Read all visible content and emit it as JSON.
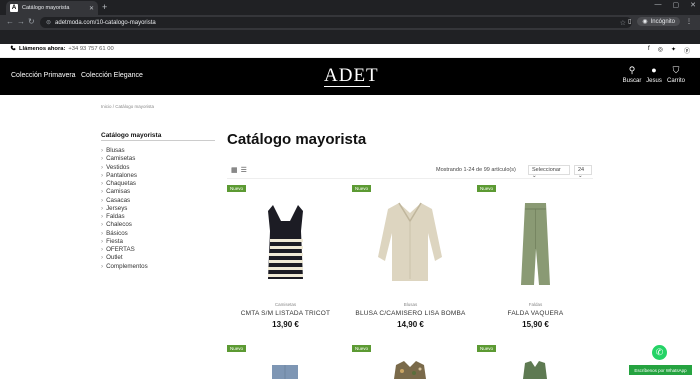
{
  "browser": {
    "tab_title": "Catálogo mayorista",
    "tab_favicon": "A",
    "url": "adetmoda.com/10-catalogo-mayorista",
    "profile_label": "Incógnito"
  },
  "topbar": {
    "phone_label": "Llámenos ahora:",
    "phone_number": "+34 93 757 61 00",
    "social_icons": [
      "facebook-icon",
      "instagram-icon",
      "twitter-icon",
      "pinterest-icon"
    ]
  },
  "nav": {
    "links": [
      "Colección Primavera",
      "Colección Elegance"
    ],
    "logo": "ADET",
    "tools": [
      {
        "icon": "search-icon",
        "label": "Buscar"
      },
      {
        "icon": "user-icon",
        "label": "Jesus"
      },
      {
        "icon": "cart-icon",
        "label": "Carrito"
      }
    ]
  },
  "breadcrumb": "Inicio  /  Catálogo mayorista",
  "sidebar": {
    "title": "Catálogo mayorista",
    "items": [
      "Blusas",
      "Camisetas",
      "Vestidos",
      "Pantalones",
      "Chaquetas",
      "Camisas",
      "Casacas",
      "Jerseys",
      "Faldas",
      "Chalecos",
      "Básicos",
      "Fiesta",
      "OFERTAS",
      "Outlet",
      "Complementos"
    ]
  },
  "main": {
    "title": "Catálogo mayorista",
    "showing": "Mostrando 1-24 de 99 artículo(s)",
    "sort_label": "Seleccionar",
    "per_page": "24"
  },
  "products": [
    {
      "badge": "Nuevo",
      "category": "Camisetas",
      "name": "CMTA S/M LISTADA TRICOT",
      "price": "13,90 €"
    },
    {
      "badge": "Nuevo",
      "category": "Blusas",
      "name": "BLUSA C/CAMISERO LISA BOMBA",
      "price": "14,90 €"
    },
    {
      "badge": "Nuevo",
      "category": "Faldas",
      "name": "FALDA VAQUERA",
      "price": "15,90 €"
    },
    {
      "badge": "Nuevo"
    },
    {
      "badge": "Nuevo"
    },
    {
      "badge": "Nuevo"
    }
  ],
  "whatsapp": {
    "label": "Escríbenos por WhatsApp"
  }
}
